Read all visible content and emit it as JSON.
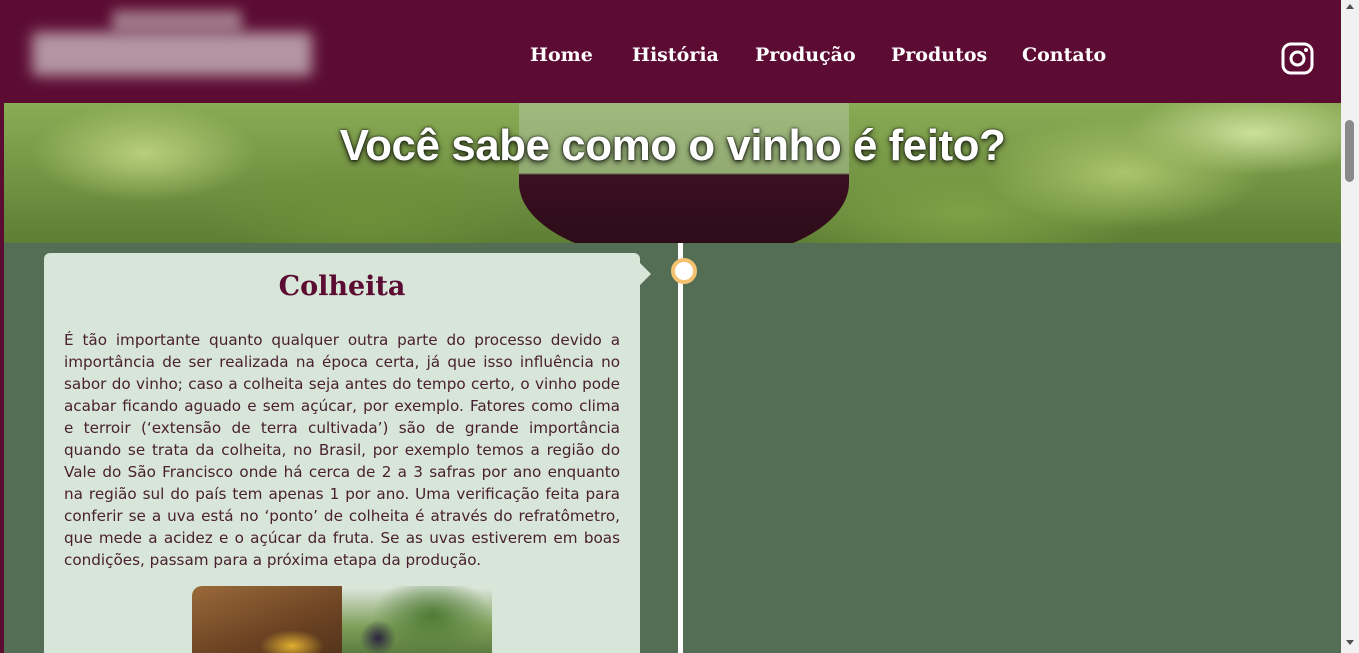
{
  "colors": {
    "header_bg": "#5c0c33",
    "page_bg": "#546e55",
    "card_bg": "#d7e6d8",
    "card_title": "#5c0c33",
    "timeline_dot_border": "#f4c271"
  },
  "header": {
    "logo_icon": "blurred-logo",
    "nav": [
      "Home",
      "História",
      "Produção",
      "Produtos",
      "Contato"
    ],
    "social_icon": "instagram-icon"
  },
  "banner": {
    "title": "Você sabe como o vinho é feito?"
  },
  "timeline": {
    "card": {
      "title": "Colheita",
      "text": "É tão importante quanto qualquer outra parte do processo devido a importância de ser realizada na época certa, já que isso influência no sabor do vinho; caso a colheita seja antes do tempo certo, o vinho pode acabar ficando aguado e sem açúcar, por exemplo. Fatores como clima e terroir (‘extensão de terra cultivada’) são de grande importância quando se trata da colheita, no Brasil, por exemplo temos a região do Vale do São Francisco onde há cerca de 2 a 3 safras por ano enquanto na região sul do país tem apenas 1 por ano. Uma verificação feita para conferir se a uva está no ‘ponto’ de colheita é através do refratômetro, que mede a acidez e o açúcar da fruta. Se as uvas estiverem em boas condições, passam para a próxima etapa da produção."
    }
  }
}
